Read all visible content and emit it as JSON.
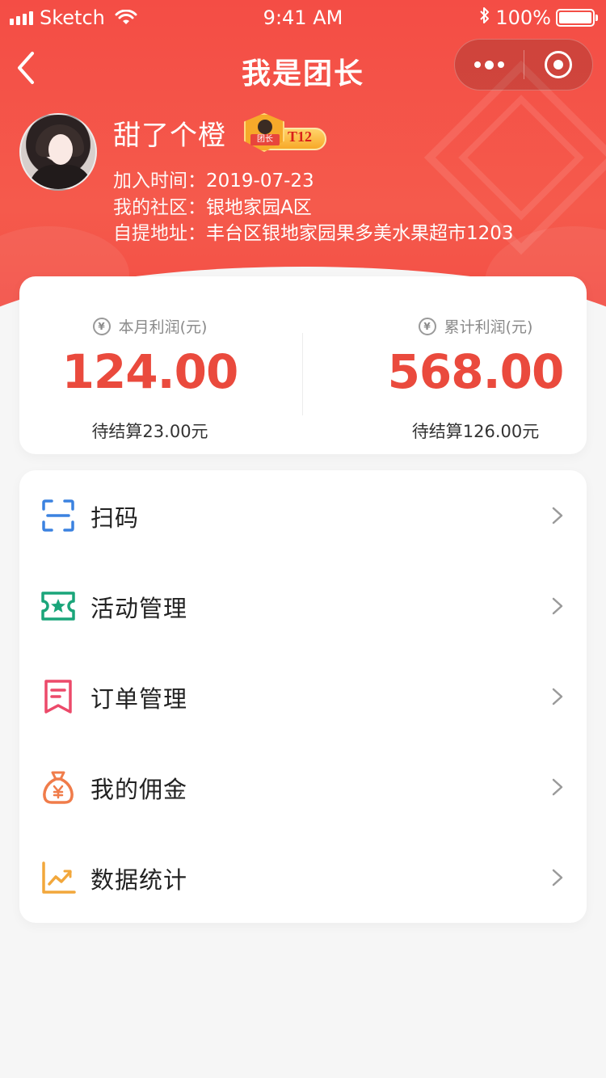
{
  "status_bar": {
    "carrier": "Sketch",
    "time": "9:41 AM",
    "battery": "100%"
  },
  "nav": {
    "title": "我是团长"
  },
  "profile": {
    "name": "甜了个橙",
    "badge_label": "团长",
    "badge_level": "T12",
    "join_label": "加入时间：",
    "join_date": "2019-07-23",
    "community_label": "我的社区：",
    "community": "银地家园A区",
    "pickup_label": "自提地址：",
    "pickup_address": "丰台区银地家园果多美水果超市1203"
  },
  "profit": {
    "month": {
      "label": "本月利润(元)",
      "amount": "124.00",
      "pending": "待结算23.00元"
    },
    "total": {
      "label": "累计利润(元)",
      "amount": "568.00",
      "pending": "待结算126.00元"
    }
  },
  "menu": [
    {
      "label": "扫码",
      "icon": "scan-icon",
      "color": "#3b82e0"
    },
    {
      "label": "活动管理",
      "icon": "activity-ticket-icon",
      "color": "#1aa57a"
    },
    {
      "label": "订单管理",
      "icon": "order-icon",
      "color": "#ec4a6a"
    },
    {
      "label": "我的佣金",
      "icon": "money-bag-icon",
      "color": "#f07c4a"
    },
    {
      "label": "数据统计",
      "icon": "trend-chart-icon",
      "color": "#f2a73b"
    }
  ],
  "colors": {
    "brand": "#f44d45",
    "amount": "#ea4a3d",
    "background": "#f6f6f6"
  }
}
